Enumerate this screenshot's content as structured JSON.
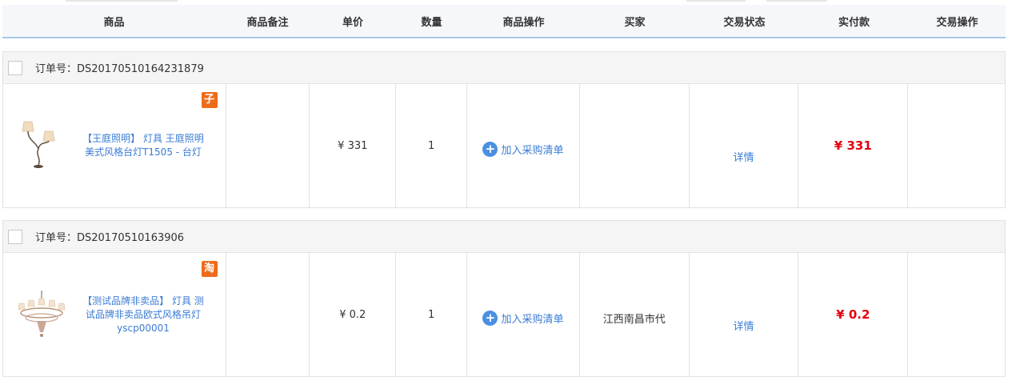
{
  "table_header": {
    "product": "商品",
    "remark": "商品备注",
    "unit_price": "单价",
    "quantity": "数量",
    "product_action": "商品操作",
    "buyer": "买家",
    "status": "交易状态",
    "paid": "实付款",
    "trade_action": "交易操作"
  },
  "orders": [
    {
      "order_label": "订单号：DS20170510164231879",
      "tag": "子",
      "tag_color": "#ee6b1a",
      "product_name": "【王庭照明】 灯具 王庭照明美式风格台灯T1505 - 台灯",
      "thumb_icon": "table-lamp-icon",
      "remark": "",
      "price": "¥ 331",
      "quantity": "1",
      "add_label": "加入采购清单",
      "buyer": "",
      "status_link": "详情",
      "paid": "¥ 331",
      "trade_action": ""
    },
    {
      "order_label": "订单号：DS20170510163906",
      "tag": "淘",
      "tag_color": "#ee6b1a",
      "product_name": "【测试品牌非卖品】 灯具 测试品牌非卖品欧式风格吊灯 yscp00001",
      "thumb_icon": "chandelier-icon",
      "remark": "",
      "price": "¥ 0.2",
      "quantity": "1",
      "add_label": "加入采购清单",
      "buyer": "江西南昌市代",
      "status_link": "详情",
      "paid": "¥ 0.2",
      "trade_action": ""
    }
  ]
}
